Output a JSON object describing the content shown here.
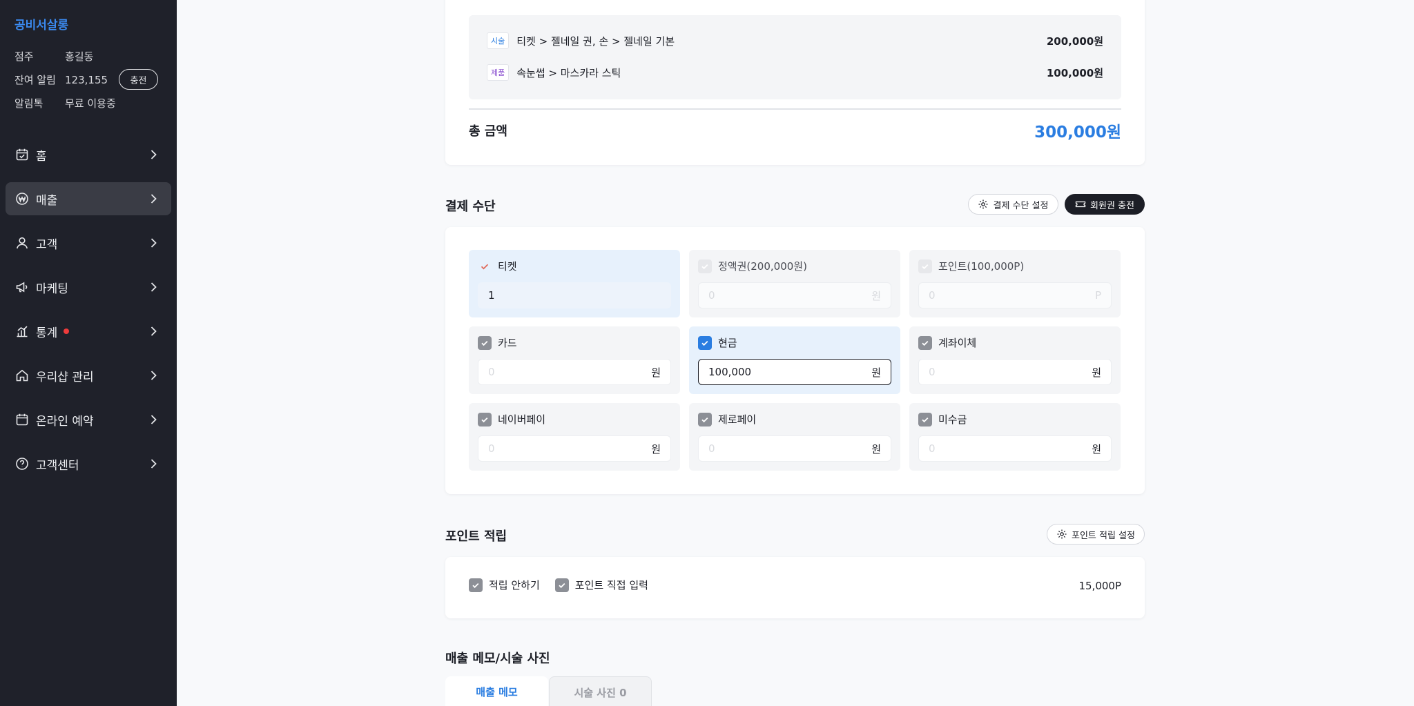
{
  "sidebar": {
    "brand": "공비서살롱",
    "owner_label": "점주",
    "owner_value": "홍길동",
    "alerts_label": "잔여 알림",
    "alerts_value": "123,155",
    "recharge_label": "충전",
    "kakao_label": "알림톡",
    "kakao_value": "무료 이용중",
    "nav": [
      {
        "label": "홈",
        "icon": "calendar-check-icon"
      },
      {
        "label": "매출",
        "icon": "won-circle-icon",
        "active": true
      },
      {
        "label": "고객",
        "icon": "person-icon"
      },
      {
        "label": "마케팅",
        "icon": "megaphone-icon"
      },
      {
        "label": "통계",
        "icon": "bar-chart-icon",
        "badge": "red-dot"
      },
      {
        "label": "우리샵 관리",
        "icon": "house-icon"
      },
      {
        "label": "온라인 예약",
        "icon": "calendar-icon"
      },
      {
        "label": "고객센터",
        "icon": "question-circle-icon"
      }
    ]
  },
  "summary": {
    "items": [
      {
        "tag": "시술",
        "name": "티켓 > 젤네일 권, 손 > 젤네일 기본",
        "price": "200,000원"
      },
      {
        "tag": "제품",
        "name": "속눈썹 > 마스카라 스틱",
        "price": "100,000원"
      }
    ],
    "total_label": "총 금액",
    "total_value": "300,000원"
  },
  "payment": {
    "title": "결제 수단",
    "settings_button": "결제 수단 설정",
    "membership_button": "회원권 충전",
    "methods": [
      {
        "label": "티켓",
        "value": "1",
        "placeholder": "",
        "unit": ""
      },
      {
        "label": "정액권(200,000원)",
        "value": "",
        "placeholder": "0",
        "unit": "원"
      },
      {
        "label": "포인트(100,000P)",
        "value": "",
        "placeholder": "0",
        "unit": "P"
      },
      {
        "label": "카드",
        "value": "",
        "placeholder": "0",
        "unit": "원"
      },
      {
        "label": "현금",
        "value": "100,000",
        "placeholder": "",
        "unit": "원"
      },
      {
        "label": "계좌이체",
        "value": "",
        "placeholder": "0",
        "unit": "원"
      },
      {
        "label": "네이버페이",
        "value": "",
        "placeholder": "0",
        "unit": "원"
      },
      {
        "label": "제로페이",
        "value": "",
        "placeholder": "0",
        "unit": "원"
      },
      {
        "label": "미수금",
        "value": "",
        "placeholder": "0",
        "unit": "원"
      }
    ]
  },
  "points": {
    "title": "포인트 적립",
    "settings_button": "포인트 적립 설정",
    "opt_no_accrue": "적립 안하기",
    "opt_manual": "포인트 직접 입력",
    "value": "15,000P"
  },
  "memo": {
    "title": "매출 메모/시술 사진",
    "tab_memo": "매출 메모",
    "tab_photo": "시술 사진 0"
  },
  "colors": {
    "accent": "#2a7de1",
    "sidebar_bg": "#1f212a",
    "alert_dot": "#ee3b3b"
  }
}
